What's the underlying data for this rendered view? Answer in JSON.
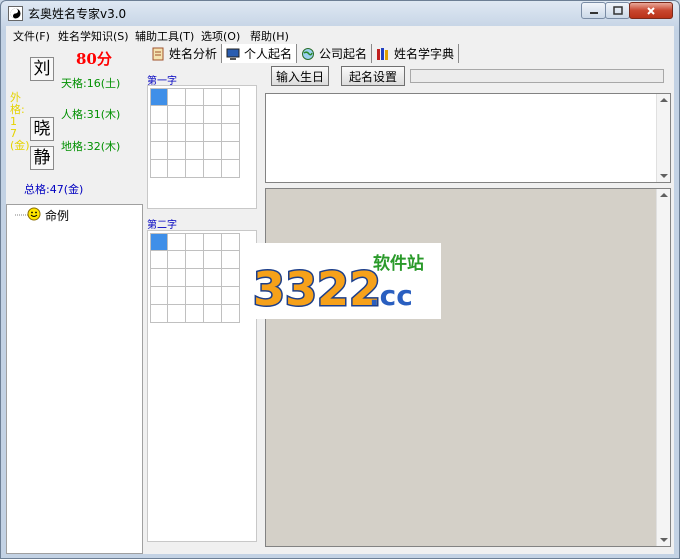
{
  "window": {
    "title": "玄奥姓名专家v3.0"
  },
  "menu": [
    {
      "label": "文件(F)"
    },
    {
      "label": "姓名学知识(S)"
    },
    {
      "label": "辅助工具(T)"
    },
    {
      "label": "选项(O)"
    },
    {
      "label": "帮助(H)"
    }
  ],
  "name_chars": [
    "刘",
    "晓",
    "静"
  ],
  "score": "80分",
  "vertical_label": "外格:17(金)",
  "ge": {
    "tian": "天格:16(土)",
    "ren": "人格:31(木)",
    "di": "地格:32(木)",
    "zong": "总格:47(金)"
  },
  "tree": {
    "root_label": "命例"
  },
  "tabs": [
    {
      "label": "姓名分析",
      "icon": "scroll-icon"
    },
    {
      "label": "个人起名",
      "icon": "computer-icon"
    },
    {
      "label": "公司起名",
      "icon": "globe-icon"
    },
    {
      "label": "姓名学字典",
      "icon": "books-icon"
    }
  ],
  "active_tab": "个人起名",
  "grid_labels": {
    "first": "第一字",
    "second": "第二字"
  },
  "buttons": {
    "input_birthday": "输入生日",
    "naming_settings": "起名设置"
  },
  "watermark": {
    "number": "3322",
    "tld": ".cc",
    "caption": "软件站"
  },
  "colors": {
    "score": "#ff0000",
    "ge_green": "#009000",
    "total_blue": "#0000c0",
    "selected_cell": "#3f8fe8"
  }
}
